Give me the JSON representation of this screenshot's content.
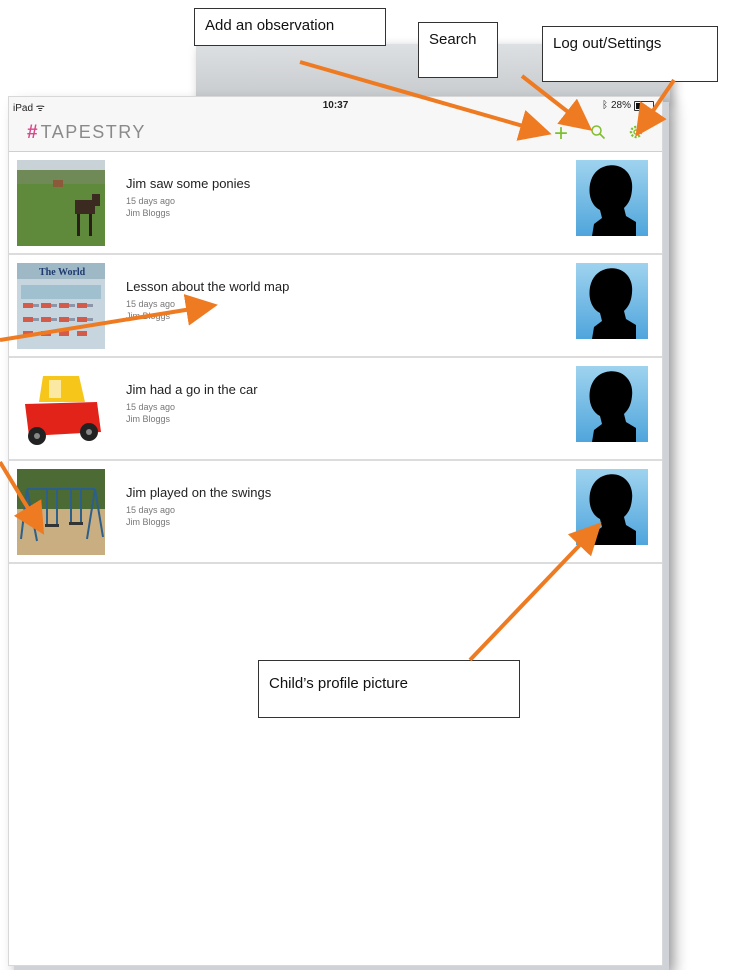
{
  "status_bar": {
    "carrier": "iPad",
    "time": "10:37",
    "battery_text": "28%"
  },
  "app": {
    "logo_mark": "#",
    "logo_text": "TAPESTRY"
  },
  "nav": {
    "add_icon": "plus-icon",
    "search_icon": "search-icon",
    "settings_icon": "gear-icon"
  },
  "observations": [
    {
      "title": "Jim saw some ponies",
      "date": "15 days ago",
      "author": "Jim Bloggs"
    },
    {
      "title": "Lesson about the world map",
      "date": "15 days ago",
      "author": "Jim Bloggs",
      "thumb_label": "The World"
    },
    {
      "title": "Jim had a go in the car",
      "date": "15 days ago",
      "author": "Jim Bloggs"
    },
    {
      "title": "Jim played on the swings",
      "date": "15 days ago",
      "author": "Jim Bloggs"
    }
  ],
  "callouts": {
    "add": "Add an observation",
    "search": "Search",
    "settings": "Log out/Settings",
    "profile": "Child’s profile picture"
  },
  "colors": {
    "accent": "#7fbf2f",
    "arrow": "#ee7b22",
    "logo": "#d9468a"
  }
}
